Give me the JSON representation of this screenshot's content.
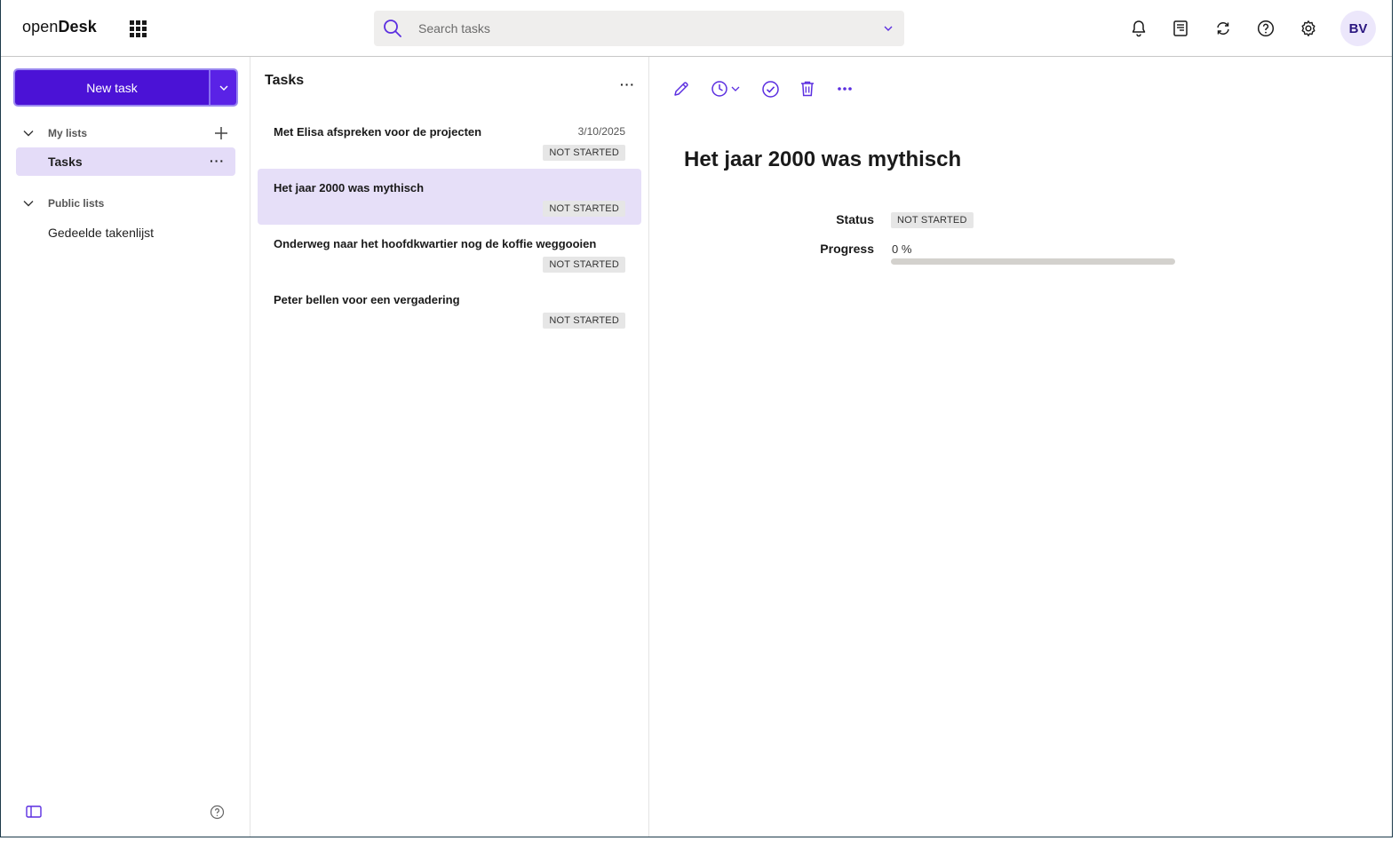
{
  "header": {
    "logo_light": "open",
    "logo_bold": "Desk",
    "search_placeholder": "Search tasks",
    "avatar_initials": "BV"
  },
  "sidebar": {
    "new_task_label": "New task",
    "my_lists_label": "My lists",
    "my_lists_items": [
      {
        "label": "Tasks",
        "active": true
      }
    ],
    "public_lists_label": "Public lists",
    "public_lists_items": [
      {
        "label": "Gedeelde takenlijst"
      }
    ]
  },
  "task_list": {
    "title": "Tasks",
    "tasks": [
      {
        "name": "Met Elisa afspreken voor de projecten",
        "date": "3/10/2025",
        "status": "NOT STARTED"
      },
      {
        "name": "Het jaar 2000 was mythisch",
        "date": "",
        "status": "NOT STARTED"
      },
      {
        "name": "Onderweg naar het hoofdkwartier nog de koffie weggooien",
        "date": "",
        "status": "NOT STARTED"
      },
      {
        "name": "Peter bellen voor een vergadering",
        "date": "",
        "status": "NOT STARTED"
      }
    ]
  },
  "detail": {
    "title": "Het jaar 2000 was mythisch",
    "status_label": "Status",
    "status_value": "NOT STARTED",
    "progress_label": "Progress",
    "progress_value": "0 %",
    "progress_fraction": 0
  },
  "colors": {
    "accent": "#4b12d6",
    "selected_bg": "#e6dff8",
    "icon_accent": "#5b2ee0"
  }
}
